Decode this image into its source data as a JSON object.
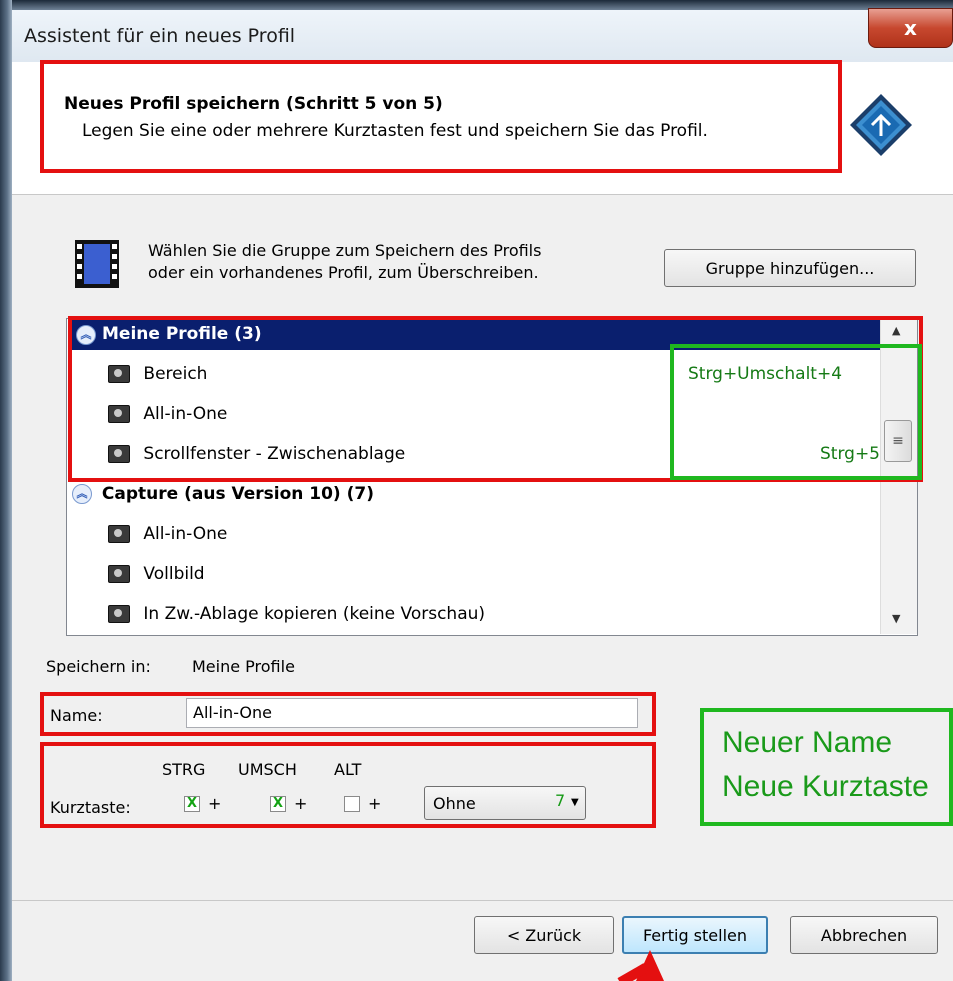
{
  "window": {
    "title": "Assistent für ein neues Profil",
    "close_label": "x"
  },
  "header": {
    "title": "Neues Profil speichern (Schritt 5 von 5)",
    "subtitle": "Legen Sie eine oder mehrere Kurztasten fest und speichern Sie das Profil."
  },
  "group_section": {
    "text_line1": "Wählen Sie die Gruppe zum  Speichern des Profils",
    "text_line2": "oder ein vorhandenes Profil, zum Überschreiben.",
    "add_group_button": "Gruppe hinzufügen..."
  },
  "profile_list": {
    "groups": [
      {
        "name": "Meine Profile (3)",
        "selected": true,
        "items": [
          {
            "name": "Bereich",
            "shortcut": "Strg+Umschalt+4"
          },
          {
            "name": "All-in-One",
            "shortcut": ""
          },
          {
            "name": "Scrollfenster - Zwischenablage",
            "shortcut": "Strg+5"
          }
        ]
      },
      {
        "name": "Capture (aus Version 10) (7)",
        "selected": false,
        "items": [
          {
            "name": "All-in-One"
          },
          {
            "name": "Vollbild"
          },
          {
            "name": "In Zw.-Ablage kopieren (keine Vorschau)"
          }
        ]
      }
    ]
  },
  "save_in": {
    "label": "Speichern in:",
    "value": "Meine Profile"
  },
  "name_field": {
    "label": "Name:",
    "value": "All-in-One"
  },
  "shortcut": {
    "header_strg": "STRG",
    "header_umsch": "UMSCH",
    "header_alt": "ALT",
    "label": "Kurztaste:",
    "plus": "+",
    "strg_checked": "X",
    "umsch_checked": "X",
    "alt_checked": "",
    "key_value": "Ohne",
    "key_annotation": "7"
  },
  "annotation_note": {
    "line1": "Neuer Name",
    "line2": "Neue Kurztaste"
  },
  "footer": {
    "back_button": "< Zurück",
    "finish_button": "Fertig stellen",
    "cancel_button": "Abbrechen"
  },
  "colors": {
    "annotation_red": "#e41010",
    "annotation_green": "#1fb81f",
    "selection": "#0a1f6e"
  }
}
